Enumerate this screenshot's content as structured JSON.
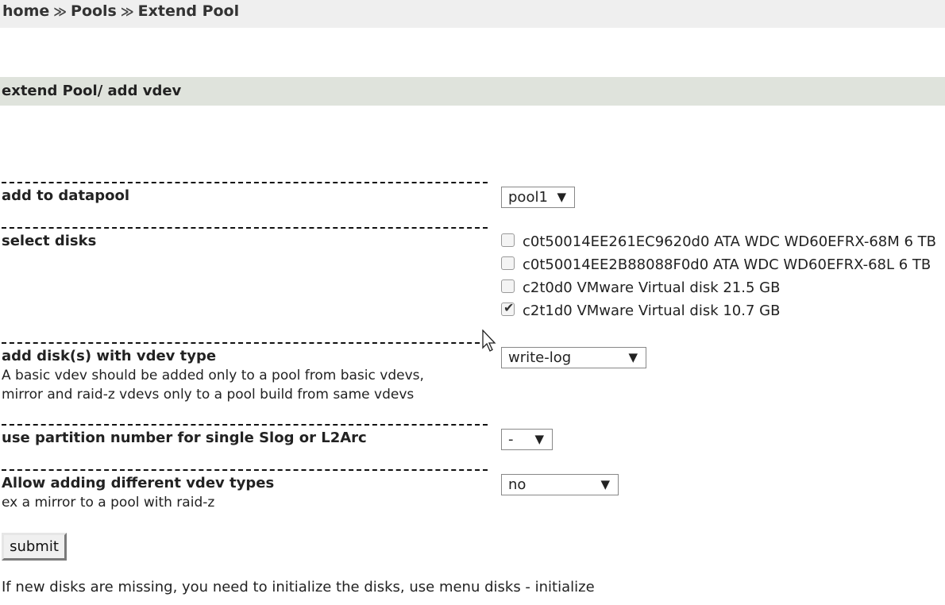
{
  "breadcrumb": {
    "items": [
      "home",
      "Pools",
      "Extend Pool"
    ],
    "separator": "≫"
  },
  "section_title": "extend Pool/ add vdev",
  "form": {
    "datapool": {
      "label": "add to datapool",
      "selected": "pool1"
    },
    "disks": {
      "label": "select disks",
      "items": [
        {
          "text": "c0t50014EE261EC9620d0 ATA WDC WD60EFRX-68M 6 TB",
          "checked": false
        },
        {
          "text": "c0t50014EE2B88088F0d0 ATA WDC WD60EFRX-68L 6 TB",
          "checked": false
        },
        {
          "text": "c2t0d0 VMware Virtual disk 21.5 GB",
          "checked": false
        },
        {
          "text": "c2t1d0 VMware Virtual disk 10.7 GB",
          "checked": true
        }
      ]
    },
    "vdev_type": {
      "label": "add disk(s) with vdev type",
      "description_line1": "A basic vdev should be added only to a pool from basic vdevs,",
      "description_line2": "mirror and raid-z vdevs only to a pool build from same vdevs",
      "selected": "write-log"
    },
    "partition": {
      "label": "use partition number for single Slog or L2Arc",
      "selected": "-"
    },
    "allow_different": {
      "label": "Allow adding different vdev types",
      "description": "ex a mirror to a pool with raid-z",
      "selected": "no"
    },
    "caret": "▼",
    "submit_label": "submit"
  },
  "footer_note": "If new disks are missing, you need to initialize the disks, use menu disks - initialize",
  "icons": {
    "checkmark": "✔",
    "cursor": "arrow-pointer"
  }
}
